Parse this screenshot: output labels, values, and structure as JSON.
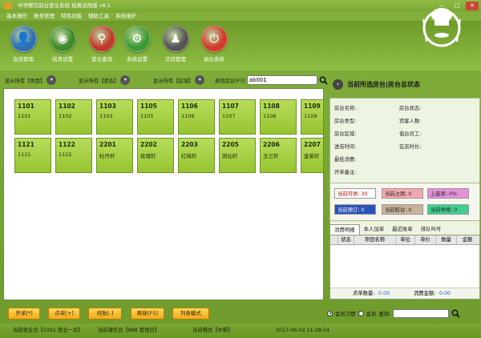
{
  "window": {
    "title": "中顶餐饮前台营业系统 经典试用版 v8.1",
    "minimize": "—",
    "maximize": "□",
    "close": "✕"
  },
  "menu": [
    "基本操作",
    "账务管理",
    "特色功能",
    "辅助工具",
    "系统维护"
  ],
  "toolbar": [
    {
      "label": "会员管理",
      "icon": "user-icon",
      "color": "#2e6fb2",
      "glyph": "👤"
    },
    {
      "label": "结清设置",
      "icon": "plate-icon",
      "color": "#3f8a2c",
      "glyph": "◉"
    },
    {
      "label": "营业查询",
      "icon": "magnifier-icon",
      "color": "#c0392b",
      "glyph": "⚲"
    },
    {
      "label": "系统设置",
      "icon": "gear-icon",
      "color": "#3c9a35",
      "glyph": "⚙"
    },
    {
      "label": "交班管理",
      "icon": "staff-icon",
      "color": "#555555",
      "glyph": "♟"
    },
    {
      "label": "退出系统",
      "icon": "power-icon",
      "color": "#d13a2a",
      "glyph": "⏻"
    }
  ],
  "filters": {
    "type_label": "显示所有【类型】",
    "status_label": "显示所有【状态】",
    "area_label": "显示所有【区域】",
    "search_label": "查找房台[F3]",
    "search_value": "ab001"
  },
  "rooms": [
    {
      "no": "1101",
      "name": "1101"
    },
    {
      "no": "1102",
      "name": "1102"
    },
    {
      "no": "1103",
      "name": "1103"
    },
    {
      "no": "1105",
      "name": "1105"
    },
    {
      "no": "1106",
      "name": "1106"
    },
    {
      "no": "1107",
      "name": "1107"
    },
    {
      "no": "1108",
      "name": "1108"
    },
    {
      "no": "1109",
      "name": "1109"
    },
    {
      "no": "1121",
      "name": "1121"
    },
    {
      "no": "1122",
      "name": "1122"
    },
    {
      "no": "2201",
      "name": "牡丹轩"
    },
    {
      "no": "2202",
      "name": "玫瑰轩"
    },
    {
      "no": "2203",
      "name": "红梅轩"
    },
    {
      "no": "2205",
      "name": "凤仙轩"
    },
    {
      "no": "2206",
      "name": "玉兰轩"
    },
    {
      "no": "2207",
      "name": "金菊轩"
    }
  ],
  "actions": [
    "开单[*]",
    "点单[+]",
    "结账[-]",
    "刷新[F5]",
    "列表模式"
  ],
  "right_panel": {
    "title": "当前所选房台|房台总状态",
    "info_left": [
      "房台名称:",
      "房台类型:",
      "房台区域:",
      "进店时间:",
      "最低消费:",
      "开单备注:"
    ],
    "info_right": [
      "房台状态:",
      "宾客人数:",
      "值台员工:",
      "在店时长:"
    ],
    "status_chips": [
      {
        "label": "当前可供: 30",
        "color": "#ffffff",
        "text": "#c00000"
      },
      {
        "label": "当前占用: 0",
        "color": "#f4a6b0",
        "text": "#222222"
      },
      {
        "label": "上座率: 0%",
        "color": "#e590d8",
        "text": "#222222"
      },
      {
        "label": "当前预订: 0",
        "color": "#2a52b8",
        "text": "#ffffff"
      },
      {
        "label": "当前脏台: 0",
        "color": "#c9b49a",
        "text": "#222222"
      },
      {
        "label": "当前停用: 0",
        "color": "#3fd08f",
        "text": "#222222"
      }
    ],
    "tabs": [
      "消费明细",
      "本人加单",
      "最近账单",
      "排队叫号"
    ],
    "table_headers": [
      "状态",
      "项目名称",
      "单位",
      "单价",
      "数量",
      "金额"
    ],
    "points_label": "点单数量:",
    "points_value": "0.00",
    "amount_label": "消费金额:",
    "amount_value": "0.00",
    "member_options": [
      "会员习惯",
      "会员"
    ],
    "query_label": "查询:"
  },
  "statusbar": {
    "business_day": "当前营业点【1001 营业一点】",
    "operator": "当前操作员【888 管理员】",
    "meal": "当前餐段【中餐】",
    "datetime": "2017-06-02 11:28:14"
  }
}
